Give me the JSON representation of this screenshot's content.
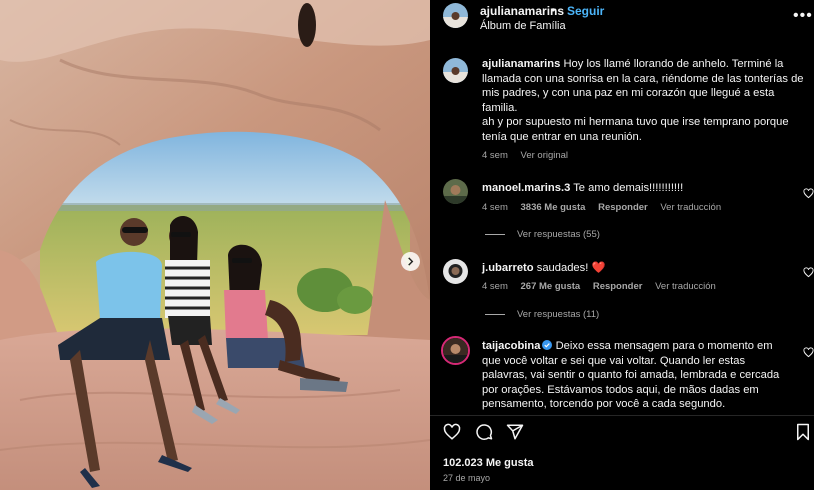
{
  "post": {
    "username": "ajulianamarins",
    "separator": "•",
    "follow_label": "Seguir",
    "subtitle": "Álbum de Família",
    "more_icon": "more-horizontal-icon"
  },
  "caption": {
    "username": "ajulianamarins",
    "line1": "Hoy los llamé llorando de anhelo. Terminé la llamada con una sonrisa en la cara, riéndome de las tonterías de mis padres, y con una paz en mi corazón que llegué a esta familia.",
    "line2": "ah y por supuesto mi hermana tuvo que irse temprano porque tenía que entrar en una reunión.",
    "time": "4 sem",
    "see_original": "Ver original"
  },
  "comments": [
    {
      "username": "manoel.marins.3",
      "text": "Te amo demais!!!!!!!!!!!",
      "time": "4 sem",
      "likes": "3836 Me gusta",
      "reply": "Responder",
      "translate": "Ver traducción",
      "replies": "Ver respuestas (55)"
    },
    {
      "username": "j.ubarreto",
      "text": "saudades!",
      "emoji": "❤️",
      "time": "4 sem",
      "likes": "267 Me gusta",
      "reply": "Responder",
      "translate": "Ver traducción",
      "replies": "Ver respuestas (11)"
    },
    {
      "username": "taijacobina",
      "verified": true,
      "text": "Deixo essa mensagem para o momento em que você voltar e sei que vai voltar. Quando ler estas palavras, vai sentir o quanto foi amada, lembrada e cercada por orações. Estávamos todos aqui, de mãos dadas em pensamento, torcendo por você a cada segundo."
    }
  ],
  "actions": {
    "icons": [
      "heart-icon",
      "comment-icon",
      "share-icon",
      "bookmark-icon"
    ],
    "likes": "102.023 Me gusta",
    "date": "27 de mayo"
  },
  "colors": {
    "background": "#000000",
    "link_blue": "#4cb5f9",
    "secondary_text": "#a8a8a8",
    "verified_blue": "#3897f0"
  }
}
